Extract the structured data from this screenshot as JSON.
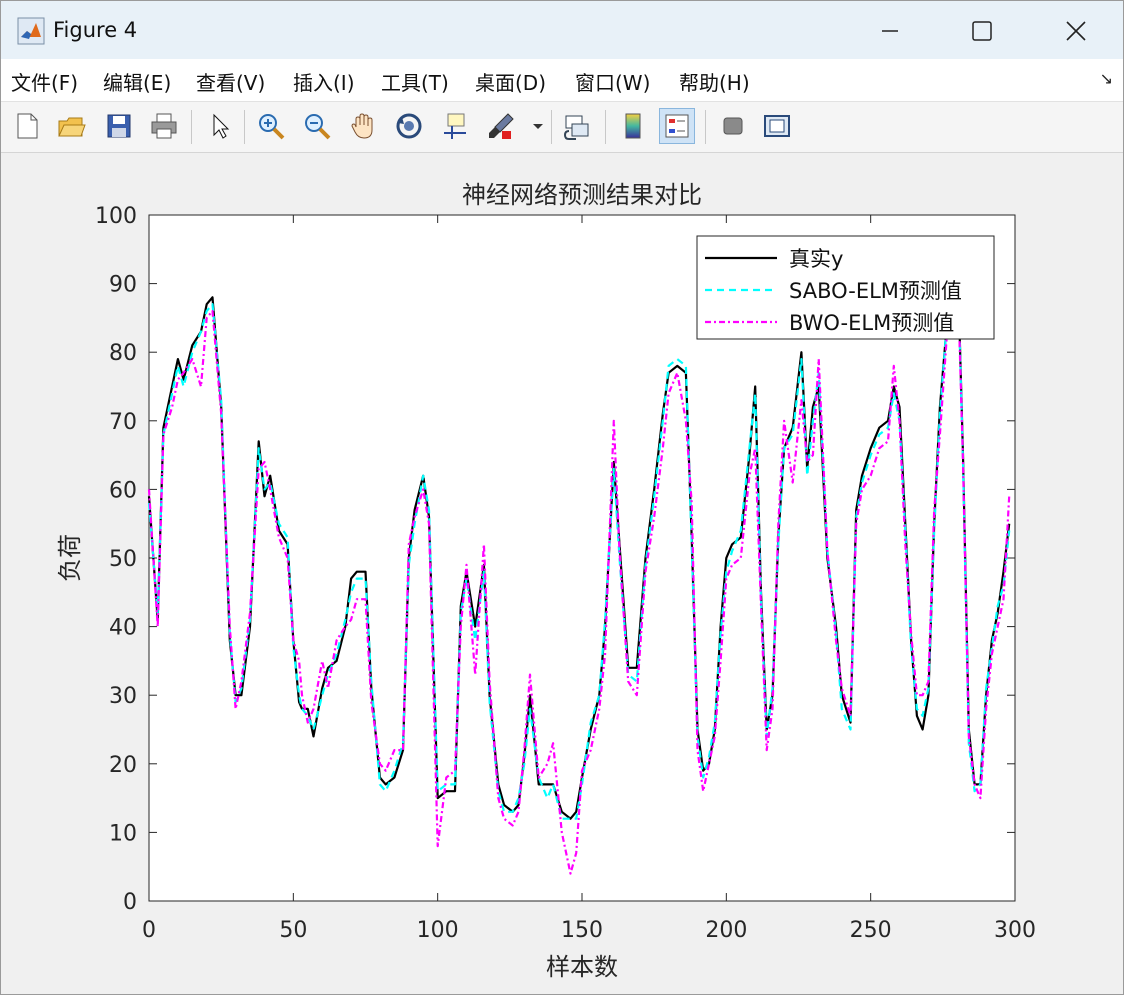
{
  "window": {
    "title": "Figure 4",
    "icon": "matlab-icon"
  },
  "menu": [
    "文件(F)",
    "编辑(E)",
    "查看(V)",
    "插入(I)",
    "工具(T)",
    "桌面(D)",
    "窗口(W)",
    "帮助(H)"
  ],
  "toolbar": [
    "new-figure-icon",
    "open-file-icon",
    "save-icon",
    "print-icon",
    "select-arrow-icon",
    "zoom-in-icon",
    "zoom-out-icon",
    "pan-hand-icon",
    "rotate-3d-icon",
    "data-cursor-icon",
    "brush-icon",
    "link-plot-icon",
    "colorbar-icon",
    "legend-icon",
    "hide-plot-tools-icon",
    "show-plot-tools-icon"
  ],
  "chart_data": {
    "type": "line",
    "title": "神经网络预测结果对比",
    "xlabel": "样本数",
    "ylabel": "负荷",
    "xlim": [
      0,
      300
    ],
    "ylim": [
      0,
      100
    ],
    "xticks": [
      0,
      50,
      100,
      150,
      200,
      250,
      300
    ],
    "yticks": [
      0,
      10,
      20,
      30,
      40,
      50,
      60,
      70,
      80,
      90,
      100
    ],
    "legend_position": "top-right",
    "x": [
      0,
      3,
      5,
      8,
      10,
      12,
      15,
      18,
      20,
      22,
      25,
      28,
      30,
      32,
      35,
      38,
      40,
      42,
      45,
      48,
      50,
      52,
      53,
      55,
      57,
      60,
      62,
      65,
      68,
      70,
      72,
      75,
      77,
      80,
      82,
      85,
      88,
      90,
      92,
      95,
      97,
      100,
      103,
      106,
      108,
      110,
      113,
      116,
      118,
      121,
      123,
      126,
      128,
      130,
      132,
      135,
      138,
      140,
      143,
      146,
      148,
      150,
      153,
      156,
      158,
      161,
      163,
      166,
      169,
      172,
      175,
      178,
      180,
      183,
      186,
      188,
      190,
      192,
      194,
      196,
      198,
      200,
      202,
      205,
      208,
      210,
      212,
      214,
      216,
      218,
      220,
      223,
      226,
      228,
      230,
      232,
      235,
      238,
      240,
      243,
      245,
      247,
      250,
      253,
      256,
      258,
      260,
      262,
      264,
      266,
      268,
      270,
      272,
      274,
      276,
      278,
      280,
      282,
      284,
      286,
      288,
      290,
      292,
      294,
      296,
      298,
      300
    ],
    "series": [
      {
        "name": "真实y",
        "color": "#000000",
        "dash": "solid",
        "values": [
          59,
          41,
          69,
          75,
          79,
          76,
          81,
          83,
          87,
          88,
          72,
          38,
          30,
          30,
          40,
          67,
          59,
          62,
          54,
          52,
          38,
          29,
          28,
          28,
          24,
          31,
          34,
          35,
          40,
          47,
          48,
          48,
          31,
          18,
          17,
          18,
          22,
          50,
          57,
          62,
          56,
          15,
          16,
          16,
          43,
          48,
          40,
          49,
          30,
          17,
          14,
          13,
          14,
          21,
          30,
          17,
          17,
          17,
          13,
          12,
          13,
          18,
          25,
          30,
          40,
          64,
          52,
          34,
          34,
          50,
          60,
          71,
          77,
          78,
          77,
          53,
          25,
          19,
          20,
          25,
          40,
          50,
          52,
          53,
          65,
          75,
          45,
          25,
          30,
          53,
          66,
          69,
          80,
          63,
          72,
          75,
          50,
          40,
          30,
          26,
          57,
          62,
          66,
          69,
          70,
          75,
          72,
          55,
          38,
          27,
          25,
          30,
          55,
          72,
          82,
          92,
          95,
          65,
          25,
          17,
          17,
          30,
          38,
          42,
          48,
          55
        ]
      },
      {
        "name": "SABO-ELM预测值",
        "color": "#00ffff",
        "dash": "dashed",
        "values": [
          58,
          42,
          68,
          74,
          78,
          75,
          80,
          83,
          86,
          87,
          73,
          39,
          29,
          31,
          41,
          66,
          60,
          61,
          55,
          53,
          37,
          30,
          28,
          27,
          25,
          30,
          33,
          36,
          41,
          45,
          47,
          47,
          32,
          17,
          16,
          19,
          23,
          49,
          55,
          62,
          57,
          16,
          17,
          17,
          42,
          47,
          38,
          48,
          29,
          16,
          13,
          13,
          15,
          20,
          28,
          18,
          15,
          17,
          12,
          12,
          12,
          17,
          26,
          30,
          41,
          63,
          50,
          33,
          32,
          49,
          59,
          70,
          78,
          79,
          78,
          52,
          24,
          18,
          21,
          26,
          39,
          48,
          51,
          54,
          66,
          74,
          44,
          24,
          31,
          52,
          66,
          68,
          79,
          62,
          70,
          77,
          51,
          39,
          28,
          25,
          56,
          61,
          65,
          68,
          69,
          74,
          70,
          54,
          37,
          28,
          27,
          31,
          54,
          71,
          82,
          91,
          95,
          64,
          23,
          16,
          17,
          31,
          37,
          43,
          46,
          54
        ]
      },
      {
        "name": "BWO-ELM预测值",
        "color": "#ff00ff",
        "dash": "dashdot",
        "values": [
          60,
          40,
          68,
          72,
          76,
          77,
          79,
          75,
          85,
          86,
          71,
          40,
          28,
          32,
          42,
          63,
          64,
          60,
          53,
          50,
          38,
          35,
          30,
          26,
          28,
          35,
          31,
          38,
          40,
          41,
          44,
          44,
          29,
          20,
          19,
          22,
          22,
          52,
          56,
          60,
          55,
          8,
          18,
          19,
          40,
          49,
          33,
          52,
          32,
          15,
          12,
          11,
          13,
          22,
          33,
          18,
          20,
          23,
          10,
          4,
          7,
          19,
          22,
          28,
          36,
          70,
          51,
          32,
          30,
          48,
          56,
          66,
          74,
          77,
          70,
          58,
          22,
          16,
          20,
          24,
          35,
          47,
          49,
          50,
          62,
          66,
          43,
          22,
          28,
          55,
          70,
          61,
          73,
          64,
          65,
          79,
          51,
          38,
          31,
          27,
          55,
          60,
          62,
          66,
          67,
          78,
          70,
          52,
          39,
          30,
          30,
          32,
          57,
          68,
          80,
          92,
          93,
          64,
          24,
          17,
          15,
          28,
          36,
          40,
          44,
          59
        ]
      }
    ]
  }
}
